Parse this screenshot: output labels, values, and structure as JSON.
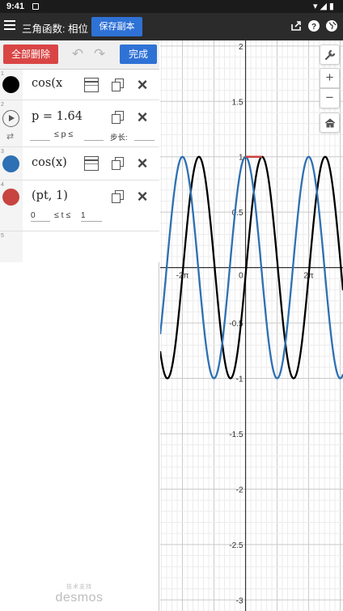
{
  "status_bar": {
    "time": "9:41",
    "system_icons": "▾◢▮"
  },
  "app_bar": {
    "title": "三角函数: 相位",
    "save_copy_label": "保存副本",
    "icons": [
      "share-icon",
      "help-icon",
      "globe-icon"
    ]
  },
  "toolbar": {
    "delete_all_label": "全部删除",
    "done_label": "完成"
  },
  "expressions": [
    {
      "index": "1",
      "latex": "cos(x",
      "color": "#000000"
    },
    {
      "index": "2",
      "latex": "p = 1.64",
      "range_label": "≤ p ≤",
      "step_label": "步长:"
    },
    {
      "index": "3",
      "latex": "cos(x)",
      "color": "#2d70b3"
    },
    {
      "index": "4",
      "latex": "(pt, 1)",
      "color": "#c74440",
      "range_min": "0",
      "range_label": "≤ t ≤",
      "range_max": "1"
    },
    {
      "index": "5"
    }
  ],
  "watermark": {
    "prefix": "技术支持",
    "brand": "desmos"
  },
  "chart_data": {
    "type": "line",
    "xlim": [
      -8.5,
      9.7
    ],
    "ylim": [
      -3.1,
      2.05
    ],
    "x_ticks": [
      {
        "value": -6.283,
        "label": "-2π"
      },
      {
        "value": 0,
        "label": "0"
      },
      {
        "value": 6.283,
        "label": "2π"
      }
    ],
    "y_ticks": [
      {
        "value": 2,
        "label": "2"
      },
      {
        "value": 1.5,
        "label": "1.5"
      },
      {
        "value": 1,
        "label": "1"
      },
      {
        "value": 0.5,
        "label": "0.5"
      },
      {
        "value": -0.5,
        "label": "-0.5"
      },
      {
        "value": -1,
        "label": "-1"
      },
      {
        "value": -1.5,
        "label": "-1.5"
      },
      {
        "value": -2,
        "label": "-2"
      },
      {
        "value": -2.5,
        "label": "-2.5"
      },
      {
        "value": -3,
        "label": "-3"
      }
    ],
    "grid": true,
    "series": [
      {
        "expression": "cos(x - 1.64)",
        "color": "#000000",
        "phase": 1.64
      },
      {
        "expression": "cos(x)",
        "color": "#2d70b3",
        "phase": 0
      },
      {
        "expression": "(pt, 1), 0 ≤ t ≤ 1",
        "color": "#c74440",
        "segment": [
          [
            0,
            1
          ],
          [
            1.64,
            1
          ]
        ]
      }
    ]
  }
}
